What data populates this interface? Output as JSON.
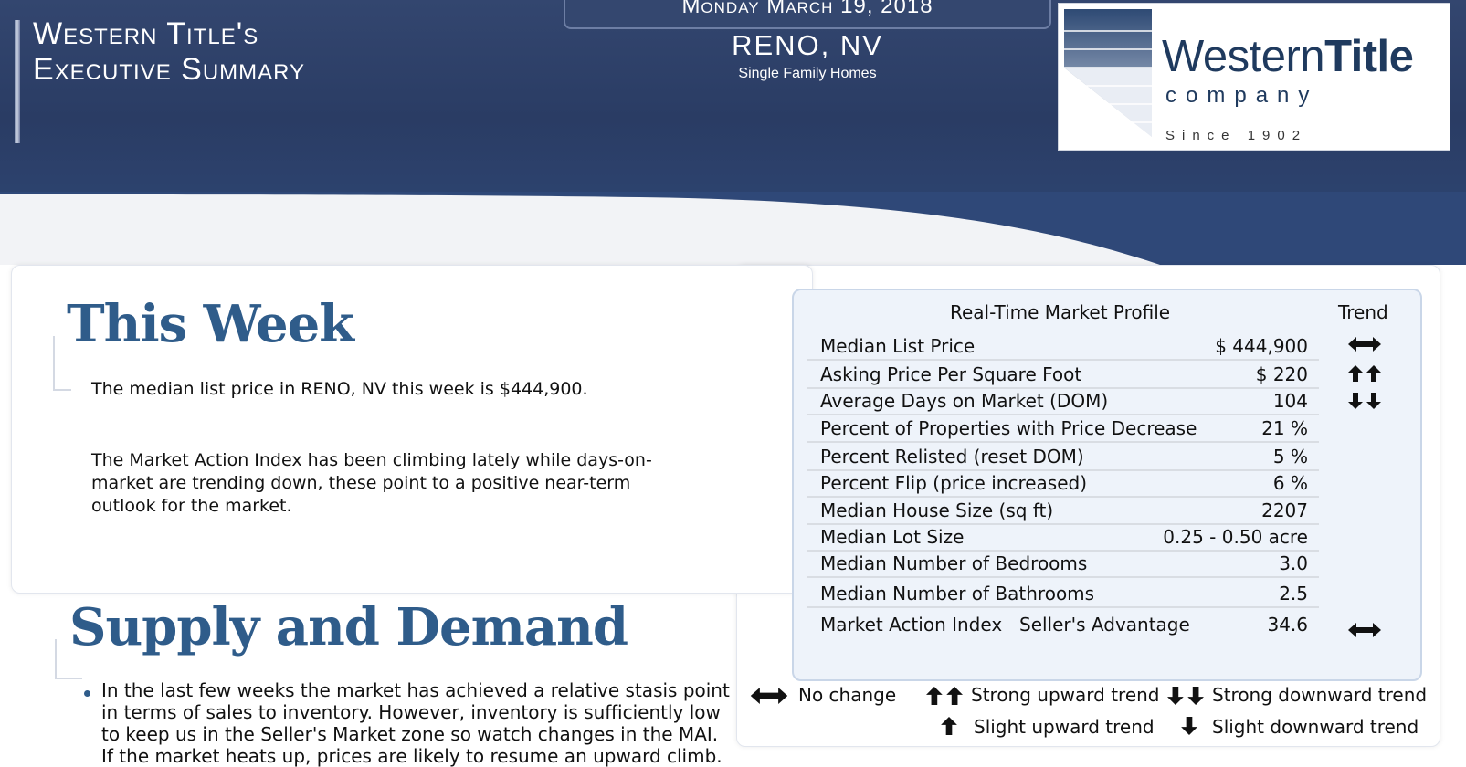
{
  "header": {
    "title_line1": "Western Title's",
    "title_line2": "Executive Summary",
    "date": "Monday March 19, 2018",
    "city": "RENO, NV",
    "subtitle": "Single Family Homes"
  },
  "logo": {
    "western": "Western",
    "title": "Title",
    "company": "company",
    "since": "Since 1902"
  },
  "this_week": {
    "heading": "This Week",
    "para1": "The median list price in RENO, NV this week is $444,900.",
    "para2_line1": "The Market Action Index has been climbing lately while days-on-",
    "para2_line2": "market are trending down, these point to a positive near-term",
    "para2_line3": "outlook for the market."
  },
  "supply_demand": {
    "heading": "Supply and Demand",
    "line1": "In the last few weeks the market has achieved a relative stasis point",
    "line2": "in terms of sales to inventory.  However, inventory is sufficiently low",
    "line3": "to keep us in the Seller's Market zone so watch changes in the MAI.",
    "line4": "If the market heats up, prices are likely to resume an upward climb."
  },
  "profile": {
    "header": "Real-Time Market Profile",
    "trend_header": "Trend",
    "rows": [
      {
        "label": "Median List Price",
        "value": "$ 444,900",
        "trend": "no-change"
      },
      {
        "label": "Asking Price Per Square Foot",
        "value": "$ 220",
        "trend": "strong-up"
      },
      {
        "label": "Average Days on Market (DOM)",
        "value": "104",
        "trend": "strong-down"
      },
      {
        "label": "Percent of Properties with Price Decrease",
        "value": "21 %",
        "trend": ""
      },
      {
        "label": "Percent Relisted (reset DOM)",
        "value": "5 %",
        "trend": ""
      },
      {
        "label": "Percent Flip (price increased)",
        "value": "6 %",
        "trend": ""
      },
      {
        "label": "Median House Size (sq ft)",
        "value": "2207",
        "trend": ""
      },
      {
        "label": "Median Lot Size",
        "value": "0.25 - 0.50 acre",
        "trend": ""
      },
      {
        "label": "Median Number of Bedrooms",
        "value": "3.0",
        "trend": ""
      },
      {
        "label": "Median Number of Bathrooms",
        "value": "2.5",
        "trend": ""
      },
      {
        "label": "Market Action Index",
        "middle": "Seller's Advantage",
        "value": "34.6",
        "trend": "no-change"
      }
    ]
  },
  "legend": {
    "no_change": "No change",
    "strong_up": "Strong upward trend",
    "strong_down": "Strong downward trend",
    "slight_up": "Slight upward trend",
    "slight_down": "Slight downward trend"
  },
  "colors": {
    "banner": "#2f4570",
    "heading": "#2f5c8a",
    "profile_bg": "#eef3fa"
  },
  "icons": {
    "no_change": "double-horizontal-arrow-icon",
    "strong_up": "double-up-arrow-icon",
    "strong_down": "double-down-arrow-icon",
    "slight_up": "up-arrow-icon",
    "slight_down": "down-arrow-icon"
  }
}
